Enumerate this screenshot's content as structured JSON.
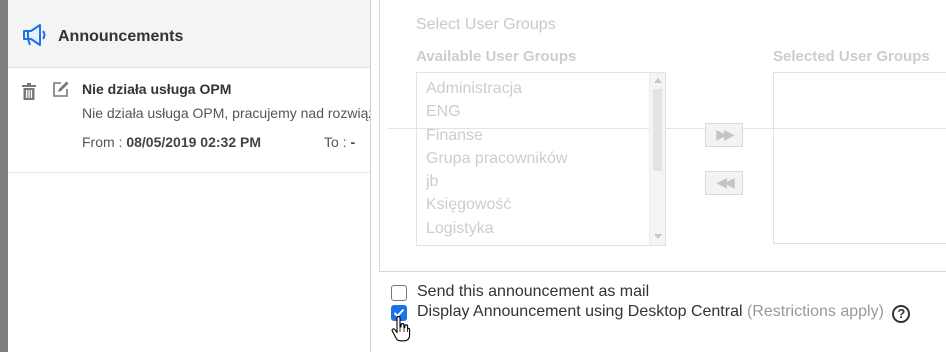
{
  "announcements": {
    "title": "Announcements",
    "item": {
      "title": "Nie działa usługa OPM",
      "description": "Nie działa usługa OPM, pracujemy nad rozwiązaniem problemu",
      "from_label": "From : ",
      "from_value": "08/05/2019 02:32 PM",
      "to_label": "To : ",
      "to_value": "-"
    }
  },
  "dialog": {
    "section_title": "Select User Groups",
    "available_label": "Available User Groups",
    "selected_label": "Selected User Groups",
    "available_groups": [
      "Administracja",
      "ENG",
      "Finanse",
      "Grupa pracowników",
      "jb",
      "Księgowość",
      "Logistyka"
    ],
    "move_right_symbol": "▶▶",
    "move_left_symbol": "◀◀",
    "send_mail_label": "Send this announcement as mail",
    "send_mail_checked": false,
    "display_label": "Display Announcement using Desktop Central",
    "display_checked": true,
    "restrictions_label": "(Restrictions apply)",
    "help_symbol": "?"
  },
  "colors": {
    "accent": "#1a73e8",
    "disabled_text": "#cdcdcd"
  }
}
